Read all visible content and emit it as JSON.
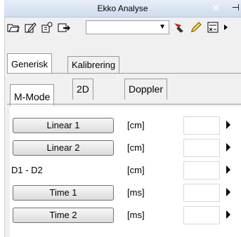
{
  "window": {
    "title": "Ekko Analyse",
    "close_glyph": "✕",
    "pin_glyph": "⊣"
  },
  "toolbar": {
    "icons": [
      "open-icon",
      "edit-icon",
      "settings-icon",
      "export-icon"
    ],
    "right_icons": [
      "red-marker-icon",
      "pencil-icon",
      "calculator-icon"
    ],
    "combo_value": ""
  },
  "tabs_top": [
    {
      "label": "Generisk",
      "active": true
    },
    {
      "label": "Kalibrering",
      "active": false
    }
  ],
  "tabs_mode": [
    {
      "label": "M-Mode",
      "active": true
    },
    {
      "label": "2D",
      "active": false
    },
    {
      "label": "Doppler",
      "active": false
    }
  ],
  "rows": [
    {
      "label": "Linear 1",
      "type": "button",
      "unit": "[cm]",
      "value": ""
    },
    {
      "label": "Linear 2",
      "type": "button",
      "unit": "[cm]",
      "value": ""
    },
    {
      "label": "D1 - D2",
      "type": "text",
      "unit": "[cm]",
      "value": ""
    },
    {
      "label": "Time 1",
      "type": "button",
      "unit": "[ms]",
      "value": ""
    },
    {
      "label": "Time 2",
      "type": "button",
      "unit": "[ms]",
      "value": ""
    }
  ]
}
